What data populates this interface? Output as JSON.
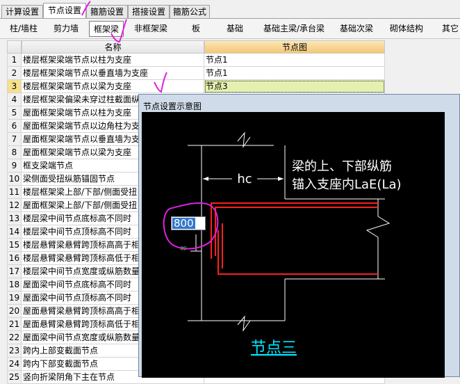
{
  "tabs": [
    "计算设置",
    "节点设置",
    "箍筋设置",
    "搭接设置",
    "箍筋公式"
  ],
  "toolbar": [
    "柱/墙柱",
    "剪力墙",
    "框架梁",
    "非框架梁",
    "板",
    "基础",
    "基础主梁/承台梁",
    "基础次梁",
    "砌体结构",
    "其它"
  ],
  "grid": {
    "headers": {
      "name": "名称",
      "value": "节点图"
    },
    "rows": [
      {
        "no": "1",
        "name": "楼层框架梁端节点以柱为支座",
        "value": "节点1"
      },
      {
        "no": "2",
        "name": "楼层框架梁端节点以垂直墙为支座",
        "value": "节点1"
      },
      {
        "no": "3",
        "name": "楼层框架梁端节点以梁为支座",
        "value": "节点3"
      },
      {
        "no": "4",
        "name": "楼层框架梁偏梁未穿过柱截面纵向",
        "value": ""
      },
      {
        "no": "5",
        "name": "屋面框架梁端节点以柱为支座",
        "value": ""
      },
      {
        "no": "6",
        "name": "屋面框架梁端节点以边角柱为支",
        "value": ""
      },
      {
        "no": "7",
        "name": "屋面框架梁端节点以垂直墙为支",
        "value": ""
      },
      {
        "no": "8",
        "name": "屋面框架梁端节点以梁为支座",
        "value": ""
      },
      {
        "no": "9",
        "name": "框支梁端节点",
        "value": ""
      },
      {
        "no": "10",
        "name": "梁侧面受扭纵筋锚固节点",
        "value": ""
      },
      {
        "no": "11",
        "name": "楼层框架梁上部/下部/侧面受扭",
        "value": ""
      },
      {
        "no": "12",
        "name": "屋面框架梁上部/下部/侧面受扭",
        "value": ""
      },
      {
        "no": "13",
        "name": "楼层梁中间节点底标高不同时",
        "value": ""
      },
      {
        "no": "14",
        "name": "楼层梁中间节点顶标高不同时",
        "value": ""
      },
      {
        "no": "15",
        "name": "楼层悬臂梁悬臂跨顶标高高于相",
        "value": ""
      },
      {
        "no": "16",
        "name": "楼层悬臂梁悬臂跨顶标高低于相",
        "value": ""
      },
      {
        "no": "17",
        "name": "楼层梁中间节点宽度或纵筋数量",
        "value": ""
      },
      {
        "no": "18",
        "name": "屋面梁中间节点底标高不同时",
        "value": ""
      },
      {
        "no": "19",
        "name": "屋面梁中间节点顶标高不同时",
        "value": ""
      },
      {
        "no": "20",
        "name": "屋面悬臂梁悬臂跨顶标高高于相",
        "value": ""
      },
      {
        "no": "21",
        "name": "屋面悬臂梁悬臂跨顶标高低于相",
        "value": ""
      },
      {
        "no": "22",
        "name": "屋面梁中间节点宽度或纵筋数量",
        "value": ""
      },
      {
        "no": "23",
        "name": "跨内上部变截面节点",
        "value": ""
      },
      {
        "no": "24",
        "name": "跨内下部变截面节点",
        "value": ""
      },
      {
        "no": "25",
        "name": "竖向折梁阴角下主在节点",
        "value": ""
      }
    ]
  },
  "dialog": {
    "title": "节点设置示意图",
    "label_line1": "梁的上、下部纵筋",
    "label_line2": "锚入支座内LaE(La)",
    "hc": "hc",
    "input_value": "800",
    "infinity": "∞",
    "caption": "节点三"
  },
  "colors": {
    "accent": "#f3c778",
    "selected_row": "#e4f0b0",
    "rebar": "#ff0000",
    "caption": "#00e5ff",
    "annotation": "#e020e0"
  }
}
